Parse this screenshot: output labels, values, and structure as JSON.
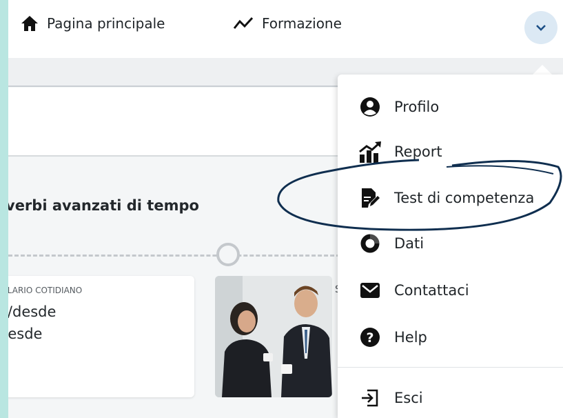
{
  "nav": {
    "home_label": "Pagina principale",
    "training_label": "Formazione"
  },
  "section": {
    "title": "verbi avanzati di tempo"
  },
  "card": {
    "category": "ULARIO COTIDIANO",
    "line1": "e/desde",
    "line2": "desde"
  },
  "menu": {
    "items": [
      {
        "label": "Profilo",
        "icon": "user-circle-icon"
      },
      {
        "label": "Report",
        "icon": "chart-growth-icon"
      },
      {
        "label": "Test di competenza",
        "icon": "document-edit-icon"
      },
      {
        "label": "Dati",
        "icon": "donut-chart-icon"
      },
      {
        "label": "Contattaci",
        "icon": "envelope-icon"
      },
      {
        "label": "Help",
        "icon": "question-circle-icon"
      },
      {
        "label": "Esci",
        "icon": "logout-icon"
      }
    ]
  },
  "colors": {
    "background": "#b9e6e1",
    "toggle": "#dce9f4",
    "highlight_stroke": "#0f2e4f"
  }
}
